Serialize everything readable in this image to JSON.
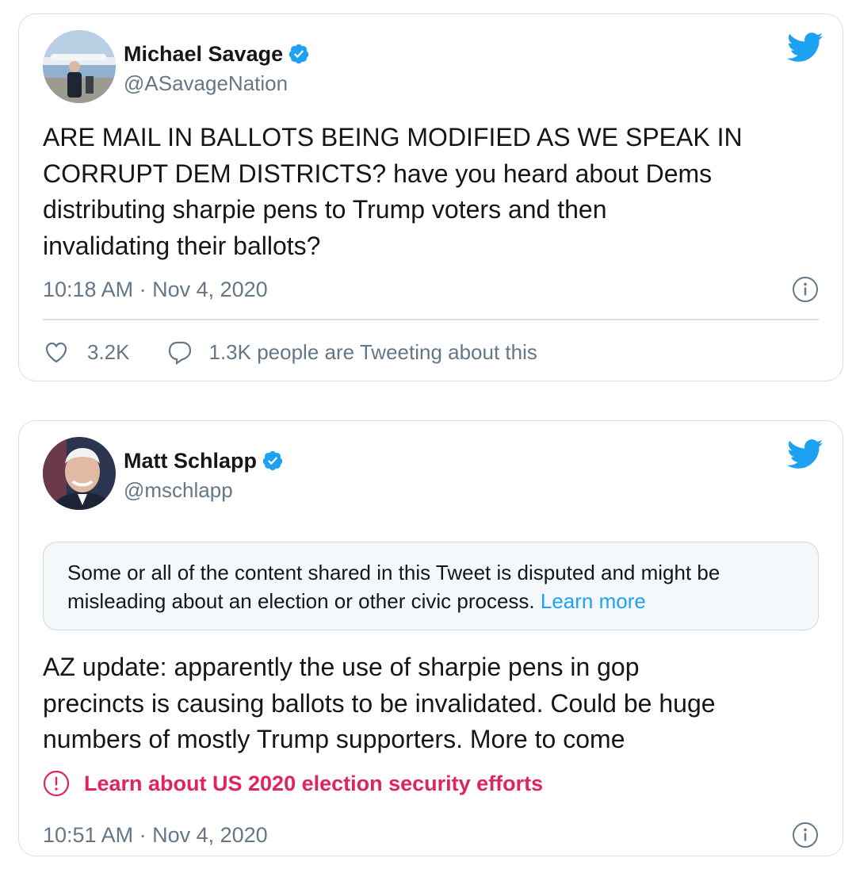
{
  "colors": {
    "brand_blue": "#1da1f2",
    "text_primary": "#14171a",
    "text_secondary": "#657786",
    "border": "#d9dee2",
    "warning_red": "#e0245e"
  },
  "tweets": [
    {
      "author_name": "Michael Savage",
      "handle": "@ASavageNation",
      "verified": true,
      "text": "ARE MAIL IN BALLOTS BEING MODIFIED  AS WE SPEAK IN\nCORRUPT  DEM  DISTRICTS?  have you heard about  Dems\ndistributing sharpie pens to Trump voters and then\ninvalidating their ballots?",
      "timestamp": "10:18 AM · Nov 4, 2020",
      "likes": "3.2K",
      "conversation": "1.3K people are Tweeting about this",
      "icons": [
        "twitter-bird-icon",
        "verified-badge-icon",
        "info-icon",
        "heart-icon",
        "reply-bubble-icon"
      ]
    },
    {
      "author_name": "Matt Schlapp",
      "handle": "@mschlapp",
      "verified": true,
      "notice_text": "Some or all of the content shared in this Tweet is disputed and might be misleading about an election or other civic process.",
      "notice_link": "Learn more",
      "text": "AZ update:  apparently the use of sharpie pens in gop\nprecincts is causing ballots to be invalidated. Could be huge\nnumbers of mostly Trump supporters. More to come",
      "election_link": "Learn about US 2020 election security efforts",
      "timestamp": "10:51 AM · Nov 4, 2020",
      "icons": [
        "twitter-bird-icon",
        "verified-badge-icon",
        "info-icon",
        "alert-circle-icon"
      ]
    }
  ]
}
